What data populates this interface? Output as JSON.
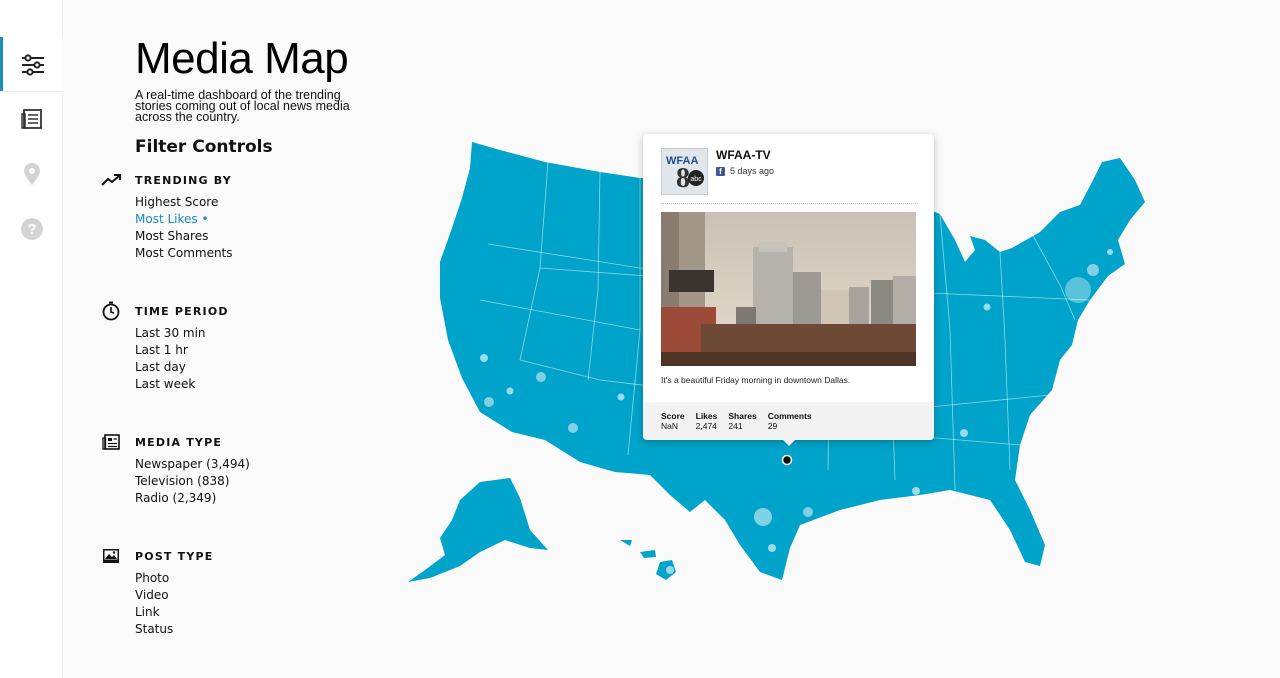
{
  "app": {
    "title": "Media Map",
    "subtitle": "A real-time dashboard of the trending stories coming out of local news media across the country."
  },
  "rail": {
    "items": [
      {
        "icon": "sliders-icon",
        "active": true
      },
      {
        "icon": "newspaper-icon",
        "active": false
      },
      {
        "icon": "location-pin-icon",
        "active": false
      },
      {
        "icon": "help-icon",
        "active": false
      }
    ]
  },
  "filters": {
    "heading": "Filter Controls",
    "trending": {
      "label": "TRENDING BY",
      "icon": "trend-up-icon",
      "options": [
        "Highest Score",
        "Most Likes •",
        "Most Shares",
        "Most Comments"
      ],
      "selected": 1
    },
    "time": {
      "label": "TIME PERIOD",
      "icon": "stopwatch-icon",
      "options": [
        "Last 30 min",
        "Last 1 hr",
        "Last day",
        "Last week"
      ]
    },
    "media": {
      "label": "MEDIA TYPE",
      "icon": "newspaper-icon",
      "options": [
        "Newspaper (3,494)",
        "Television (838)",
        "Radio (2,349)"
      ]
    },
    "post": {
      "label": "POST TYPE",
      "icon": "image-icon",
      "options": [
        "Photo",
        "Video",
        "Link",
        "Status"
      ]
    }
  },
  "popup": {
    "station": "WFAA-TV",
    "logo_text": "WFAA",
    "logo_number": "8",
    "logo_network": "abc",
    "source_icon": "facebook-icon",
    "time_ago": "5 days ago",
    "caption": "It's a beautiful Friday morning in downtown Dallas.",
    "stats": {
      "score_label": "Score",
      "score": "NaN",
      "likes_label": "Likes",
      "likes": "2,474",
      "shares_label": "Shares",
      "shares": "241",
      "comments_label": "Comments",
      "comments": "29"
    }
  },
  "colors": {
    "map_fill": "#00a3c9",
    "accent": "#1a8fb9",
    "marker": "#ffffff"
  }
}
